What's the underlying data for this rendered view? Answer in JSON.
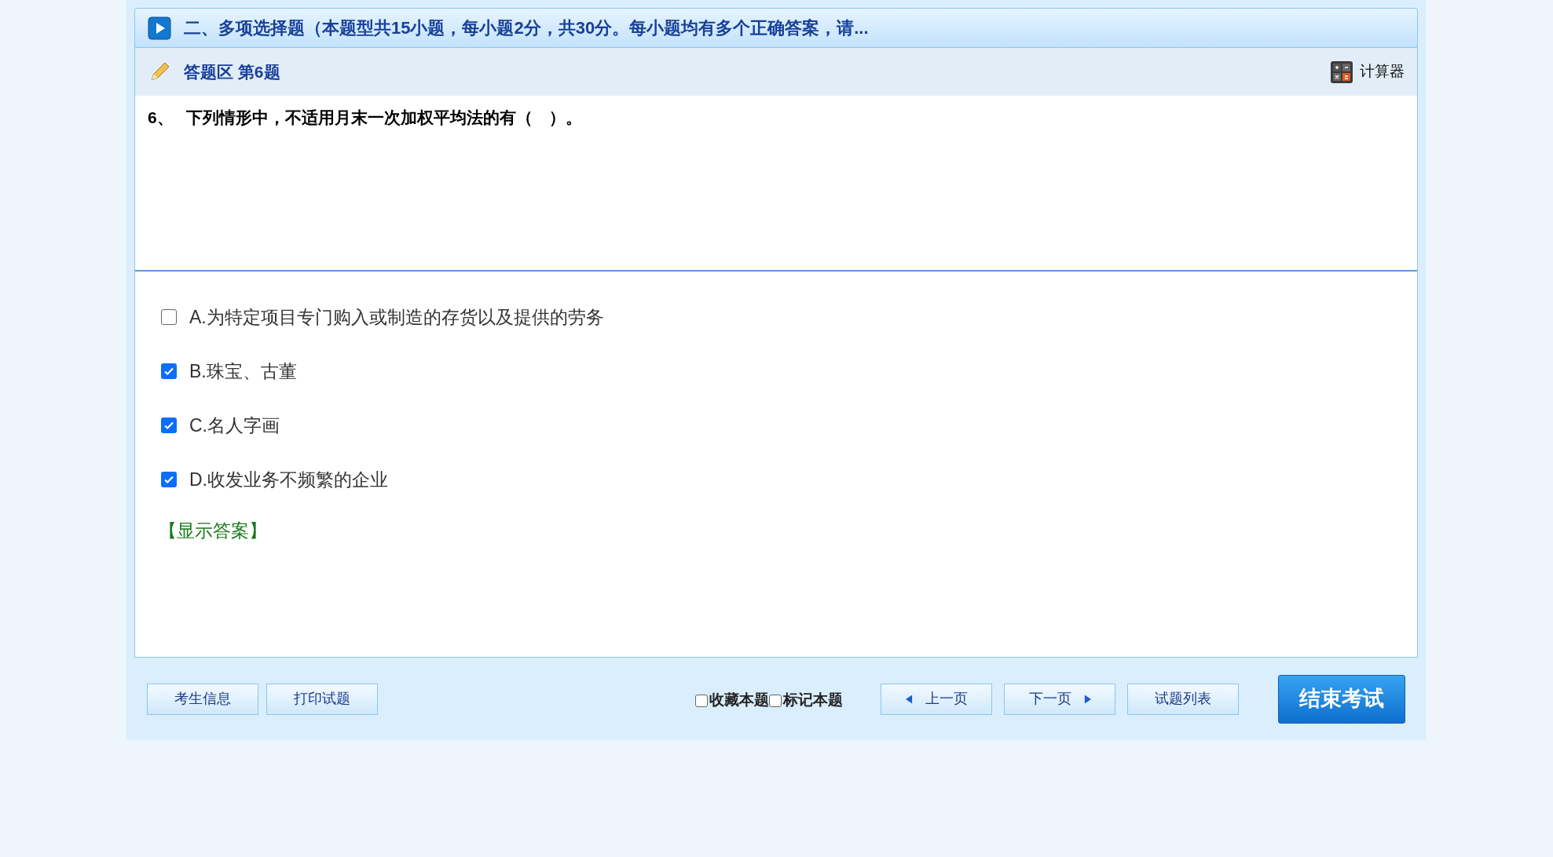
{
  "section_title": "二、多项选择题（本题型共15小题，每小题2分，共30分。每小题均有多个正确答案，请...",
  "answer_area": {
    "label": "答题区 第6题",
    "calculator": "计算器"
  },
  "question": {
    "number": "6、",
    "text": "下列情形中，不适用月末一次加权平均法的有（　）。"
  },
  "options": [
    {
      "label": "A.为特定项目专门购入或制造的存货以及提供的劳务",
      "checked": false
    },
    {
      "label": "B.珠宝、古董",
      "checked": true
    },
    {
      "label": "C.名人字画",
      "checked": true
    },
    {
      "label": "D.收发业务不频繁的企业",
      "checked": true
    }
  ],
  "show_answer": "【显示答案】",
  "footer": {
    "left_buttons": [
      "考生信息",
      "打印试题"
    ],
    "toggles": [
      {
        "label": "收藏本题",
        "checked": false
      },
      {
        "label": "标记本题",
        "checked": false
      }
    ],
    "prev": "上一页",
    "next": "下一页",
    "list": "试题列表",
    "finish": "结束考试"
  }
}
